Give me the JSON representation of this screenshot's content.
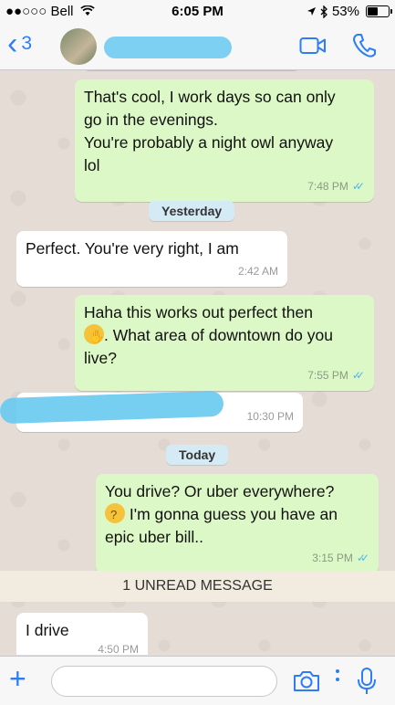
{
  "status_bar": {
    "carrier": "●●○○○ Bell",
    "time": "6:05 PM",
    "battery": "53%",
    "battery_level": 0.53
  },
  "header": {
    "back_count": "3"
  },
  "messages": [
    {
      "type": "out",
      "lines": [
        "That's cool, I work days so can only",
        "go in the evenings.",
        "You're probably a night owl anyway",
        "lol"
      ],
      "time": "7:48 PM"
    },
    {
      "type": "date",
      "label": "Yesterday"
    },
    {
      "type": "in",
      "lines": [
        "Perfect. You're very right, I am"
      ],
      "time": "2:42 AM"
    },
    {
      "type": "out",
      "lines": [
        "Haha this works out perfect then",
        ". What area of downtown do you",
        "live?"
      ],
      "time": "7:55 PM"
    },
    {
      "type": "in",
      "lines": [
        ""
      ],
      "time": "10:30 PM"
    },
    {
      "type": "date",
      "label": "Today"
    },
    {
      "type": "out",
      "lines": [
        "You drive? Or uber everywhere?",
        " I'm gonna guess you have an",
        "epic uber bill.."
      ],
      "time": "3:15 PM"
    },
    {
      "type": "unread",
      "label": "1 UNREAD MESSAGE"
    },
    {
      "type": "in",
      "lines": [
        "I drive"
      ],
      "time": "4:50 PM"
    }
  ],
  "colors": {
    "accent": "#2e7df6",
    "outgoing_bubble": "#dcf8c6",
    "incoming_bubble": "#ffffff",
    "read_ticks": "#4fb6ec",
    "chat_background": "#e5ddd5"
  },
  "icons": [
    "wifi-icon",
    "location-icon",
    "bluetooth-icon",
    "video-call-icon",
    "phone-icon",
    "camera-icon",
    "microphone-icon",
    "plus-icon"
  ]
}
